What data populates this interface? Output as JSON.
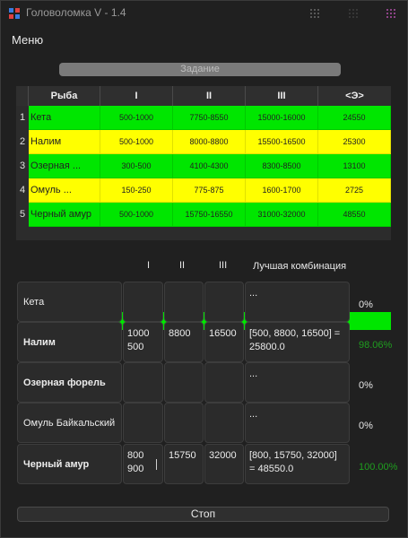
{
  "window": {
    "title": "Головоломка V - 1.4"
  },
  "menu": {
    "label": "Меню"
  },
  "task_button": {
    "label": "Задание"
  },
  "grid": {
    "headers": [
      "Рыба",
      "I",
      "II",
      "III",
      "<Э>"
    ],
    "rows": [
      {
        "num": "1",
        "name": "Кета",
        "c1": "500-1000",
        "c2": "7750-8550",
        "c3": "15000-16000",
        "c4": "24550",
        "color": "#00e600"
      },
      {
        "num": "2",
        "name": "Налим",
        "c1": "500-1000",
        "c2": "8000-8800",
        "c3": "15500-16500",
        "c4": "25300",
        "color": "#ffff00"
      },
      {
        "num": "3",
        "name": "Озерная ...",
        "c1": "300-500",
        "c2": "4100-4300",
        "c3": "8300-8500",
        "c4": "13100",
        "color": "#00e600"
      },
      {
        "num": "4",
        "name": "Омуль ...",
        "c1": "150-250",
        "c2": "775-875",
        "c3": "1600-1700",
        "c4": "2725",
        "color": "#ffff00"
      },
      {
        "num": "5",
        "name": "Черный амур",
        "c1": "500-1000",
        "c2": "15750-16550",
        "c3": "31000-32000",
        "c4": "48550",
        "color": "#00e600"
      }
    ]
  },
  "combo": {
    "col_headers": [
      "I",
      "II",
      "III"
    ],
    "best_header": "Лучшая комбинация",
    "rows": [
      {
        "name": "Кета",
        "v1": "",
        "v2": "",
        "v3": "",
        "best": "...",
        "pct": "0%",
        "pct_color": "#e8e8e8"
      },
      {
        "name": "Налим",
        "v1": "1000\n500",
        "v2": "8800",
        "v3": "16500",
        "best": "[500, 8800, 16500] = 25800.0",
        "pct": "98.06%",
        "pct_color": "#1f9e1f"
      },
      {
        "name": "Озерная форель",
        "v1": "",
        "v2": "",
        "v3": "",
        "best": "...",
        "pct": "0%",
        "pct_color": "#e8e8e8"
      },
      {
        "name": "Омуль  Байкальский",
        "v1": "",
        "v2": "",
        "v3": "",
        "best": "...",
        "pct": "0%",
        "pct_color": "#e8e8e8"
      },
      {
        "name": "Черный амур",
        "v1": "800\n900",
        "v2": "15750",
        "v3": "32000",
        "best": "[800, 15750, 32000] = 48550.0",
        "pct": "100.00%",
        "pct_color": "#1f9e1f"
      }
    ]
  },
  "stop_button": {
    "label": "Стоп"
  },
  "icons": {
    "app": "puzzle-app-icon",
    "ctrl1": "grid-dots-icon",
    "ctrl2": "grid-dots-icon",
    "ctrl3": "grid-dots-icon"
  }
}
